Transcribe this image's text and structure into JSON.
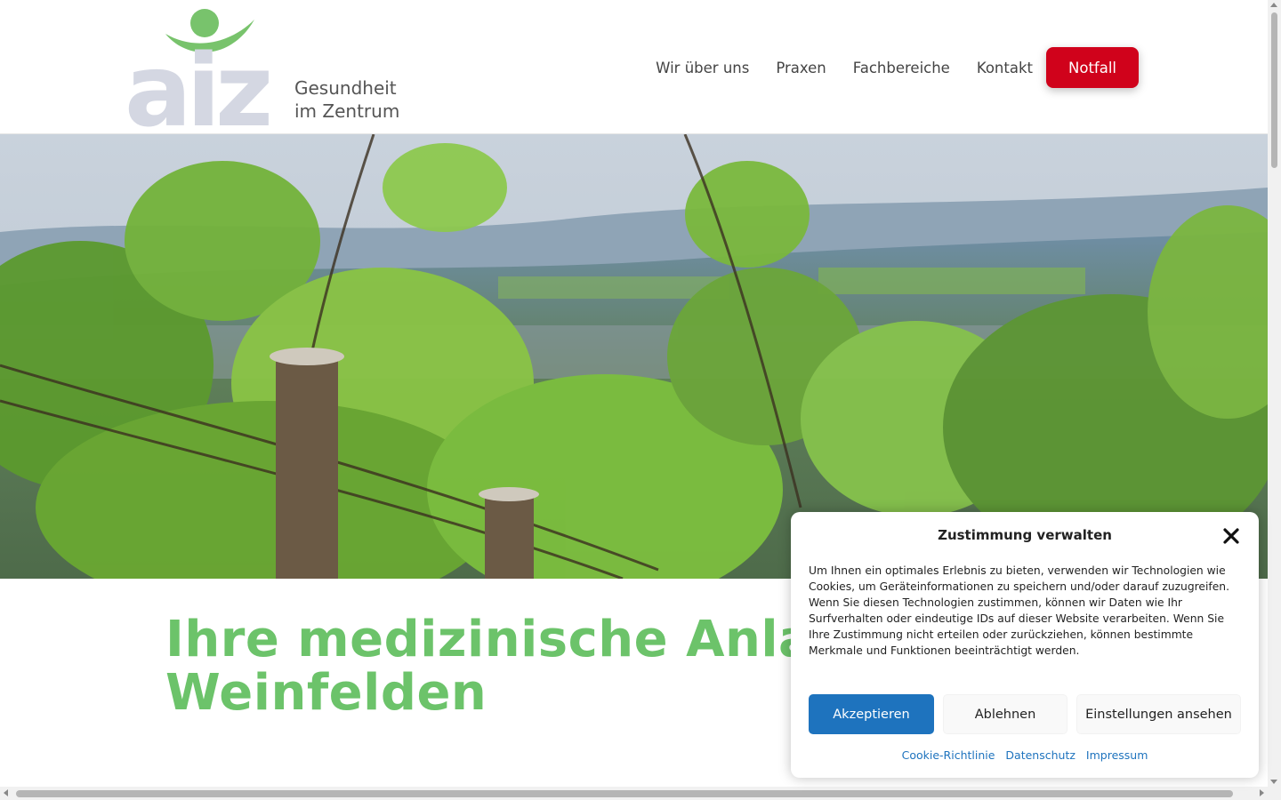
{
  "header": {
    "logo_letters": "aiz",
    "logo_line1": "Gesundheit",
    "logo_line2": "im Zentrum",
    "nav": [
      "Wir über uns",
      "Praxen",
      "Fachbereiche",
      "Kontakt"
    ],
    "emergency_label": "Notfall",
    "colors": {
      "logo_green": "#78c36c",
      "logo_gray": "#d4d7e2",
      "emergency_red": "#d0021b"
    }
  },
  "hero": {
    "description": "vineyard-landscape-photo"
  },
  "main": {
    "headline_line1": "Ihre medizinische Anlauf",
    "headline_line2": "Weinfelden",
    "headline_color": "#6cc36a"
  },
  "consent": {
    "title": "Zustimmung verwalten",
    "close_icon": "close-icon",
    "body": "Um Ihnen ein optimales Erlebnis zu bieten, verwenden wir Technologien wie Cookies, um Geräteinformationen zu speichern und/oder darauf zuzugreifen. Wenn Sie diesen Technologien zustimmen, können wir Daten wie Ihr Surfverhalten oder eindeutige IDs auf dieser Website verarbeiten. Wenn Sie Ihre Zustimmung nicht erteilen oder zurückziehen, können bestimmte Merkmale und Funktionen beeinträchtigt werden.",
    "accept_label": "Akzeptieren",
    "deny_label": "Ablehnen",
    "settings_label": "Einstellungen ansehen",
    "links": [
      "Cookie-Richtlinie",
      "Datenschutz",
      "Impressum"
    ],
    "accent_color": "#1e73be"
  }
}
